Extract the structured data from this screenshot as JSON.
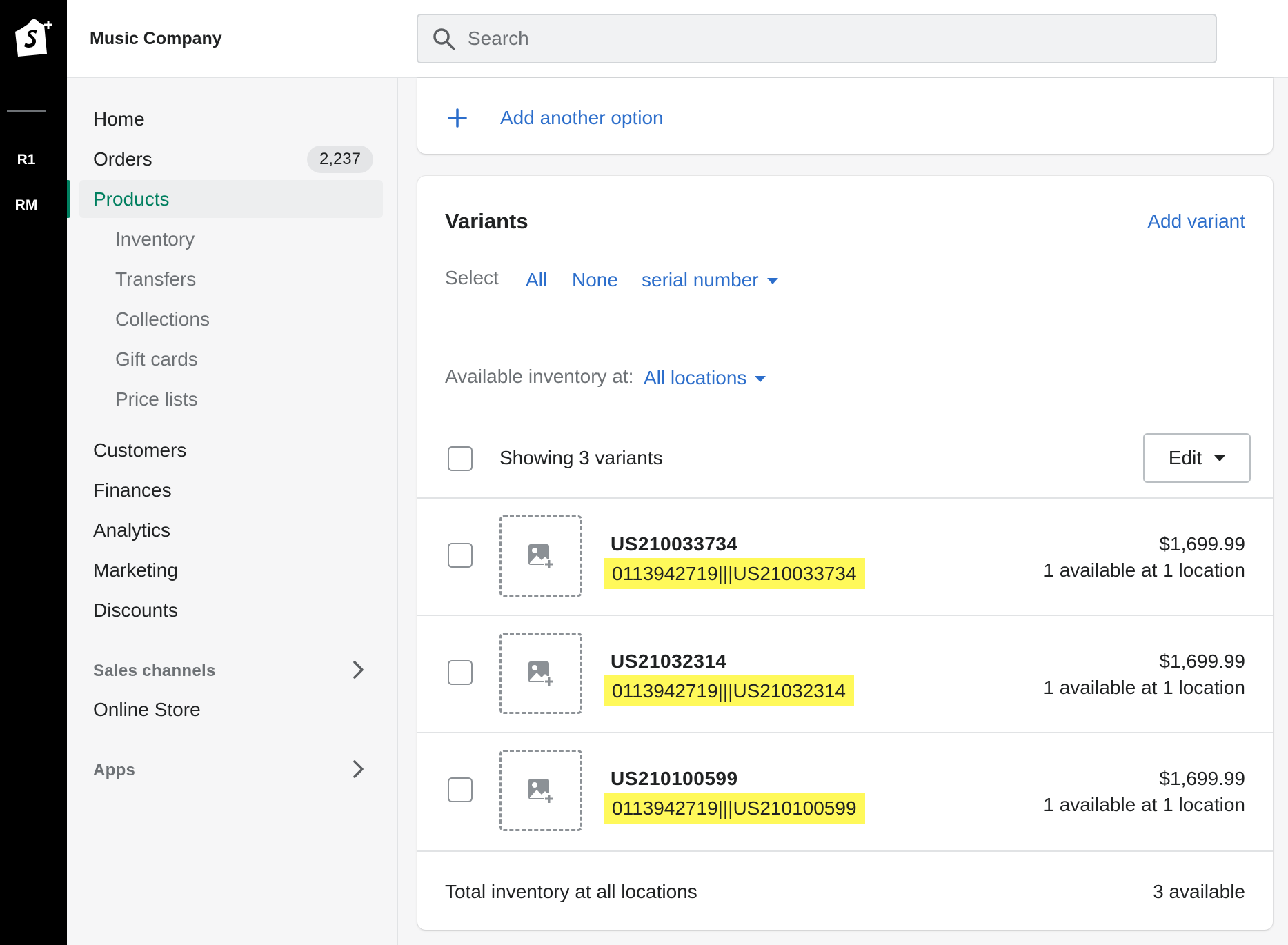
{
  "rail": {
    "stores": [
      "R1",
      "RM"
    ]
  },
  "topbar": {
    "store_name": "Music Company",
    "search_placeholder": "Search"
  },
  "sidebar": {
    "items": [
      {
        "label": "Home"
      },
      {
        "label": "Orders",
        "badge": "2,237"
      },
      {
        "label": "Products"
      },
      {
        "label": "Inventory"
      },
      {
        "label": "Transfers"
      },
      {
        "label": "Collections"
      },
      {
        "label": "Gift cards"
      },
      {
        "label": "Price lists"
      },
      {
        "label": "Customers"
      },
      {
        "label": "Finances"
      },
      {
        "label": "Analytics"
      },
      {
        "label": "Marketing"
      },
      {
        "label": "Discounts"
      }
    ],
    "sales_channels_label": "Sales channels",
    "online_store_label": "Online Store",
    "apps_label": "Apps"
  },
  "options_card": {
    "add_option_label": "Add another option"
  },
  "variants": {
    "title": "Variants",
    "add_variant_label": "Add variant",
    "select_label": "Select",
    "select_all": "All",
    "select_none": "None",
    "select_option": "serial number",
    "inventory_label": "Available inventory at:",
    "inventory_location": "All locations",
    "showing_label": "Showing 3 variants",
    "edit_label": "Edit",
    "rows": [
      {
        "title": "US210033734",
        "sku": "0113942719|||US210033734",
        "price": "$1,699.99",
        "availability": "1 available at 1 location"
      },
      {
        "title": "US21032314",
        "sku": "0113942719|||US21032314",
        "price": "$1,699.99",
        "availability": "1 available at 1 location"
      },
      {
        "title": "US210100599",
        "sku": "0113942719|||US210100599",
        "price": "$1,699.99",
        "availability": "1 available at 1 location"
      }
    ],
    "total_label": "Total inventory at all locations",
    "total_value": "3 available"
  },
  "colors": {
    "accent_link": "#2c6ecb",
    "active_nav": "#007f5f",
    "highlight": "#fff95a"
  }
}
